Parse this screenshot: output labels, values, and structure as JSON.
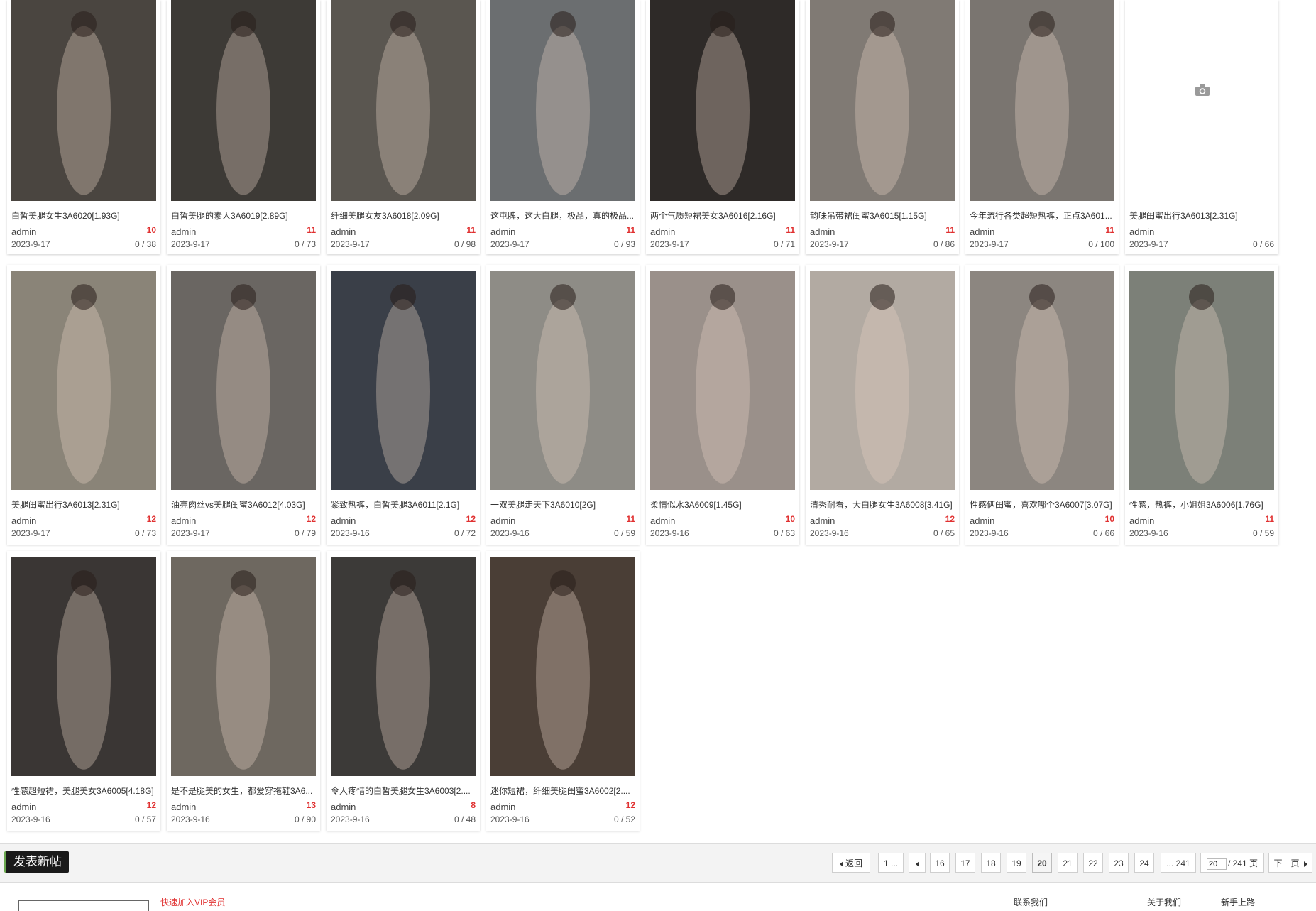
{
  "threads": [
    {
      "title": "白皙美腿女生3A6020[1.93G]",
      "author": "admin",
      "replies": "10",
      "date": "2023-9-17",
      "views": "0 / 38",
      "img": "#4a4540"
    },
    {
      "title": "白皙美腿的素人3A6019[2.89G]",
      "author": "admin",
      "replies": "11",
      "date": "2023-9-17",
      "views": "0 / 73",
      "img": "#3d3a36"
    },
    {
      "title": "纤细美腿女友3A6018[2.09G]",
      "author": "admin",
      "replies": "11",
      "date": "2023-9-17",
      "views": "0 / 98",
      "img": "#5a5650"
    },
    {
      "title": "这屯脾，这大白腿，极品，真的极品...",
      "author": "admin",
      "replies": "11",
      "date": "2023-9-17",
      "views": "0 / 93",
      "img": "#6b6e70"
    },
    {
      "title": "两个气质短裙美女3A6016[2.16G]",
      "author": "admin",
      "replies": "11",
      "date": "2023-9-17",
      "views": "0 / 71",
      "img": "#2e2a28"
    },
    {
      "title": "韵味吊带裙闺蜜3A6015[1.15G]",
      "author": "admin",
      "replies": "11",
      "date": "2023-9-17",
      "views": "0 / 86",
      "img": "#807a74"
    },
    {
      "title": "今年流行各类超短热裤，正点3A601...",
      "author": "admin",
      "replies": "11",
      "date": "2023-9-17",
      "views": "0 / 100",
      "img": "#7a7570"
    },
    {
      "title": "美腿闺蜜出行3A6013[2.31G]",
      "author": "admin",
      "replies": "",
      "date": "2023-9-17",
      "views": "0 / 66",
      "img": ""
    },
    {
      "title": "美腿闺蜜出行3A6013[2.31G]",
      "author": "admin",
      "replies": "12",
      "date": "2023-9-17",
      "views": "0 / 73",
      "img": "#8a8478"
    },
    {
      "title": "油亮肉丝vs美腿闺蜜3A6012[4.03G]",
      "author": "admin",
      "replies": "12",
      "date": "2023-9-17",
      "views": "0 / 79",
      "img": "#6a6662"
    },
    {
      "title": "紧致热裤，白皙美腿3A6011[2.1G]",
      "author": "admin",
      "replies": "12",
      "date": "2023-9-16",
      "views": "0 / 72",
      "img": "#3a3f48"
    },
    {
      "title": "一双美腿走天下3A6010[2G]",
      "author": "admin",
      "replies": "11",
      "date": "2023-9-16",
      "views": "0 / 59",
      "img": "#8e8c86"
    },
    {
      "title": "柔情似水3A6009[1.45G]",
      "author": "admin",
      "replies": "10",
      "date": "2023-9-16",
      "views": "0 / 63",
      "img": "#9a908a"
    },
    {
      "title": "清秀耐看，大白腿女生3A6008[3.41G]",
      "author": "admin",
      "replies": "12",
      "date": "2023-9-16",
      "views": "0 / 65",
      "img": "#b2aaa2"
    },
    {
      "title": "性感俩闺蜜，喜欢哪个3A6007[3.07G]",
      "author": "admin",
      "replies": "10",
      "date": "2023-9-16",
      "views": "0 / 66",
      "img": "#8c8680"
    },
    {
      "title": "性感，热裤，小姐姐3A6006[1.76G]",
      "author": "admin",
      "replies": "11",
      "date": "2023-9-16",
      "views": "0 / 59",
      "img": "#7c8078"
    },
    {
      "title": "性感超短裙，美腿美女3A6005[4.18G]",
      "author": "admin",
      "replies": "12",
      "date": "2023-9-16",
      "views": "0 / 57",
      "img": "#3a3634"
    },
    {
      "title": "是不是腿美的女生，都爱穿拖鞋3A6...",
      "author": "admin",
      "replies": "13",
      "date": "2023-9-16",
      "views": "0 / 90",
      "img": "#6e6860"
    },
    {
      "title": "令人疼惜的白皙美腿女生3A6003[2....",
      "author": "admin",
      "replies": "8",
      "date": "2023-9-16",
      "views": "0 / 48",
      "img": "#3c3a38"
    },
    {
      "title": "迷你短裙，纤细美腿闺蜜3A6002[2....",
      "author": "admin",
      "replies": "12",
      "date": "2023-9-16",
      "views": "0 / 52",
      "img": "#4a3e36"
    }
  ],
  "new_post_label": "发表新帖",
  "pager": {
    "back": "返回",
    "first": "1 ...",
    "pages": [
      "16",
      "17",
      "18",
      "19",
      "20",
      "21",
      "22",
      "23",
      "24"
    ],
    "current": "20",
    "last": "... 241",
    "input_value": "20",
    "total": "/ 241 页",
    "next": "下一页"
  },
  "footer": {
    "notice": "快速加入VIP会员",
    "link_a": "联系我们",
    "link_b": "关于我们",
    "link_c": "新手上路"
  },
  "colors": {
    "reply_count": "#e03030",
    "new_post_bg": "#1a1a1a",
    "pager_bar": "#f3f3f3"
  }
}
